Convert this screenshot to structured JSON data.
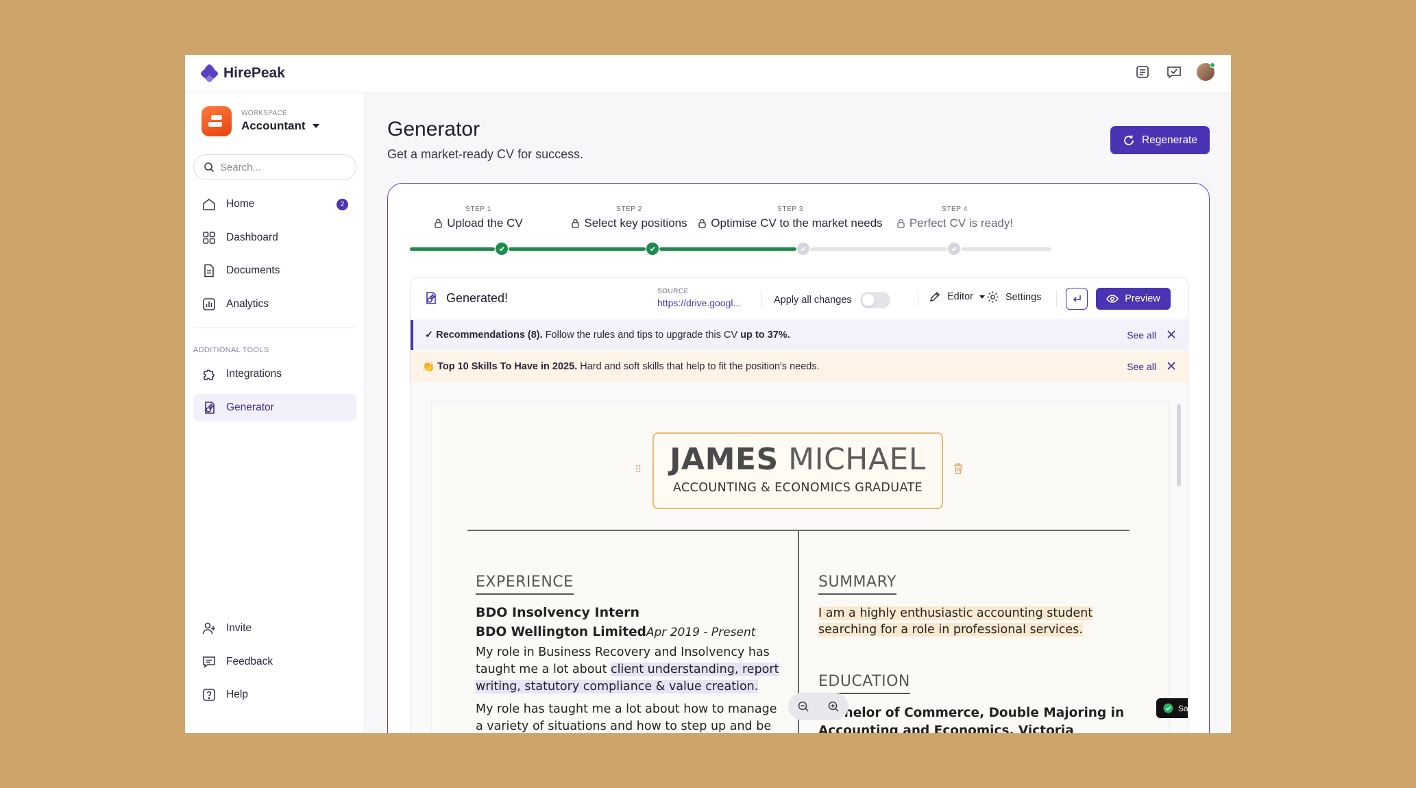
{
  "app": {
    "brand": "HirePeak"
  },
  "workspace": {
    "label": "WORKSPACE",
    "name": "Accountant"
  },
  "search": {
    "placeholder": "Search..."
  },
  "sidebar": {
    "items": [
      {
        "label": "Home",
        "badge": "2"
      },
      {
        "label": "Dashboard"
      },
      {
        "label": "Documents"
      },
      {
        "label": "Analytics"
      }
    ],
    "section_label": "ADDITIONAL TOOLS",
    "tools": [
      {
        "label": "Integrations"
      },
      {
        "label": "Generator"
      }
    ],
    "bottom": [
      {
        "label": "Invite"
      },
      {
        "label": "Feedback"
      },
      {
        "label": "Help"
      }
    ]
  },
  "page": {
    "title": "Generator",
    "subtitle": "Get a market-ready CV for success.",
    "regenerate_label": "Regenerate"
  },
  "steps": [
    {
      "num": "STEP 1",
      "label": "Upload the CV",
      "status": "done"
    },
    {
      "num": "STEP 2",
      "label": "Select key positions",
      "status": "done"
    },
    {
      "num": "STEP 3",
      "label": "Optimise CV to the market needs",
      "status": "current"
    },
    {
      "num": "STEP 4",
      "label": "Perfect CV is ready!",
      "status": "todo"
    }
  ],
  "toolbar": {
    "title": "Generated!",
    "source_label": "SOURCE",
    "source_link": "https://drive.googl...",
    "apply_label": "Apply all changes",
    "apply_on": false,
    "editor_label": "Editor",
    "settings_label": "Settings",
    "preview_label": "Preview"
  },
  "alerts": {
    "recommendations": {
      "icon": "✓",
      "bold": "Recommendations (8).",
      "text": "Follow the rules and tips to upgrade this CV",
      "bold_end": "up to 37%.",
      "see_all": "See all"
    },
    "skills": {
      "icon": "👏",
      "bold": "Top 10 Skills To Have in 2025.",
      "text": "Hard and soft skills that help to fit the position's needs.",
      "see_all": "See all"
    }
  },
  "cv": {
    "first_name": "JAMES",
    "last_name": "MICHAEL",
    "headline": "ACCOUNTING & ECONOMICS GRADUATE",
    "experience_heading": "EXPERIENCE",
    "job_title": "BDO Insolvency Intern",
    "company": "BDO Wellington Limited",
    "dates": "Apr 2019 - Present",
    "para1_a": "My role in Business Recovery and Insolvency has taught me a lot about",
    "para1_hl": "client understanding, report writing, statutory compliance & value creation.",
    "para2": "My role has taught me a lot about how to manage a variety of situations and how to step up and be",
    "summary_heading": "SUMMARY",
    "summary_text": "I am a highly enthusiastic accounting student searching for a role in professional services.",
    "education_heading": "EDUCATION",
    "degree": "Bachelor of Commerce, Double Majoring in Accounting and Economics, Victoria"
  },
  "status": {
    "saved_label": "Saved!"
  }
}
